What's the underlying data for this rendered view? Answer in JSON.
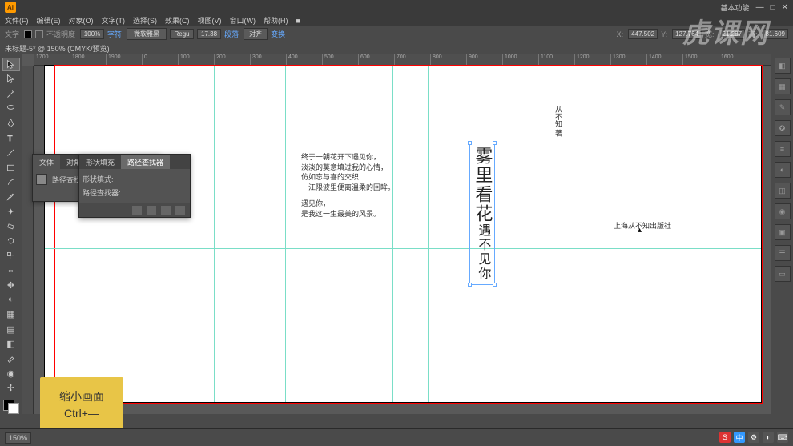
{
  "titlebar": {
    "app": "Ai",
    "workspace": "基本功能",
    "min": "—",
    "max": "□",
    "close": "✕"
  },
  "menu": [
    "文件(F)",
    "编辑(E)",
    "对象(O)",
    "文字(T)",
    "选择(S)",
    "效果(C)",
    "视图(V)",
    "窗口(W)",
    "帮助(H)",
    "■"
  ],
  "ctrl": {
    "label": "文字",
    "noSel": "不透明度",
    "opacity": "100%",
    "stroke": "字符",
    "font": "微软雅黑",
    "style": "Regu",
    "size": "17.38",
    "pt": "段落",
    "align": "对齐",
    "set": "变换",
    "x": "X:",
    "xv": "447.502",
    "y": "Y:",
    "yv": "127.764",
    "w": "宽:",
    "wv": "21.287",
    "h": "高:",
    "hv": "81.609"
  },
  "docTab": "未标题-5* @ 150% (CMYK/预览)",
  "ruler": [
    "1700",
    "1800",
    "1900",
    "0",
    "100",
    "200",
    "300",
    "400",
    "500",
    "600",
    "700",
    "800",
    "900",
    "1000",
    "1100",
    "1200",
    "1300",
    "1400",
    "1500",
    "1600",
    "1700"
  ],
  "poem": {
    "p1": "终于一朝花开下遇见你，\n淡淡的莫意填过我的心情，\n仿如忘与喜的交织\n一江限波里便离温柔的回眸。",
    "p2": "遇见你，\n是我这一生最美的风景。"
  },
  "title": {
    "col1": "雾里看花",
    "col2": "遇不见你"
  },
  "author": "从不知  著",
  "publisher": "上海从不知出版社",
  "panel": {
    "tabs1": [
      "文体",
      "对角"
    ],
    "tabs2": [
      "形状填充",
      "路径查找器"
    ],
    "row1": "形状填式:",
    "row2": "路径查找器:"
  },
  "tooltip": {
    "l1": "缩小画面",
    "l2": "Ctrl+—"
  },
  "status": {
    "zoom": "150%"
  },
  "watermark": "虎课网",
  "colors": {
    "accent": "#6af",
    "guide": "#7adec7",
    "tip": "#e8c547"
  }
}
